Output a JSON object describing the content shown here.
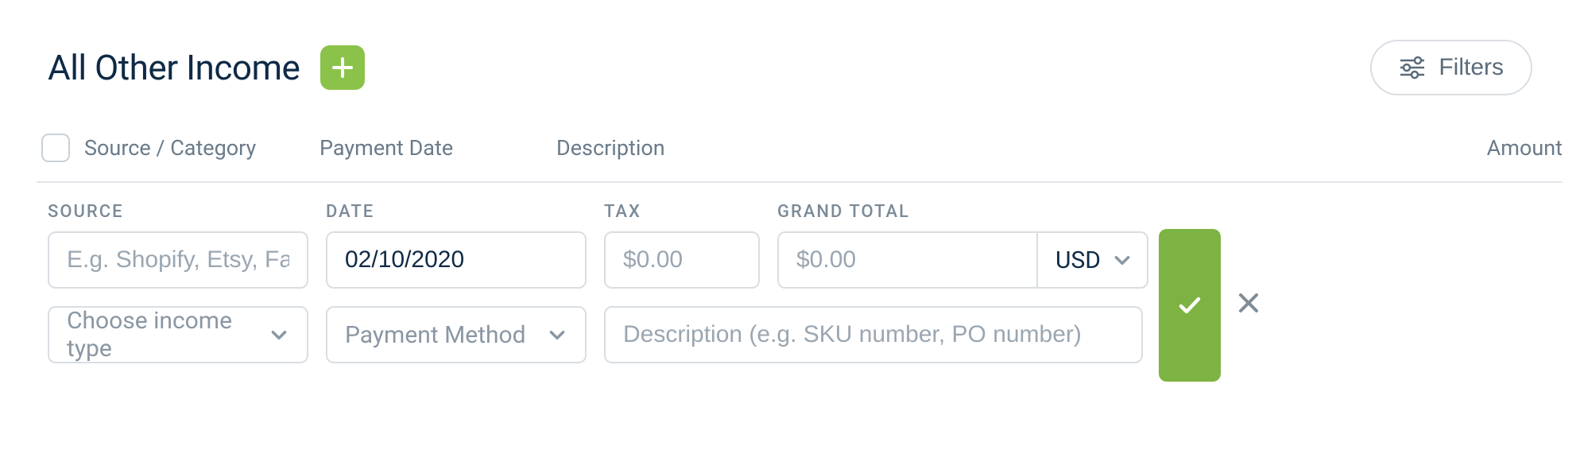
{
  "header": {
    "title": "All Other Income",
    "filters_label": "Filters"
  },
  "table_headers": {
    "source": "Source / Category",
    "payment_date": "Payment Date",
    "description": "Description",
    "amount": "Amount"
  },
  "form": {
    "labels": {
      "source": "SOURCE",
      "date": "DATE",
      "tax": "TAX",
      "grand_total": "GRAND TOTAL"
    },
    "placeholders": {
      "source": "E.g. Shopify, Etsy, Farme",
      "tax": "$0.00",
      "grand_total": "$0.00",
      "income_type": "Choose income type",
      "payment_method": "Payment Method",
      "description": "Description (e.g. SKU number, PO number)"
    },
    "values": {
      "date": "02/10/2020",
      "currency": "USD"
    }
  }
}
